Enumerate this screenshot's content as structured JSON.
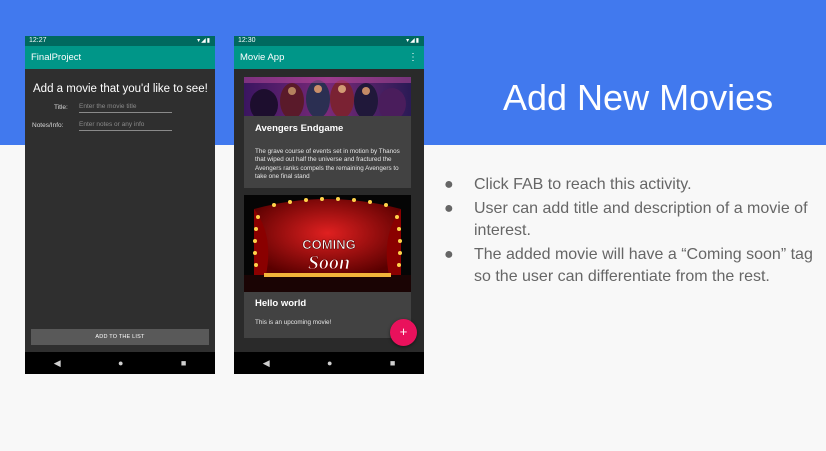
{
  "slide": {
    "title": "Add New Movies",
    "bullets": [
      "Click FAB to reach this activity.",
      "User can add title and description of a movie of interest.",
      "The added movie will have a “Coming soon” tag so the user can differentiate from the rest."
    ],
    "colors": {
      "banner": "#4179ee",
      "bullet_text": "#666666"
    }
  },
  "phone1": {
    "status_time": "12:27",
    "app_title": "FinalProject",
    "heading": "Add a movie that you'd like to see!",
    "title_label": "Title:",
    "title_placeholder": "Enter the movie title",
    "notes_label": "Notes/Info:",
    "notes_placeholder": "Enter notes or any info",
    "button_label": "ADD TO THE LIST"
  },
  "phone2": {
    "status_time": "12:30",
    "app_title": "Movie App",
    "cards": [
      {
        "title": "Avengers Endgame",
        "description": "The grave course of events set in motion by Thanos that wiped out half the universe and fractured the Avengers ranks compels the remaining Avengers to take one final stand"
      },
      {
        "title": "Hello world",
        "description": "This is an upcoming movie!",
        "poster_text": [
          "COMING",
          "Soon"
        ]
      }
    ],
    "fab_label": "+"
  },
  "colors": {
    "status_bar": "#00695f",
    "app_bar": "#009688",
    "fab": "#e9115c"
  }
}
